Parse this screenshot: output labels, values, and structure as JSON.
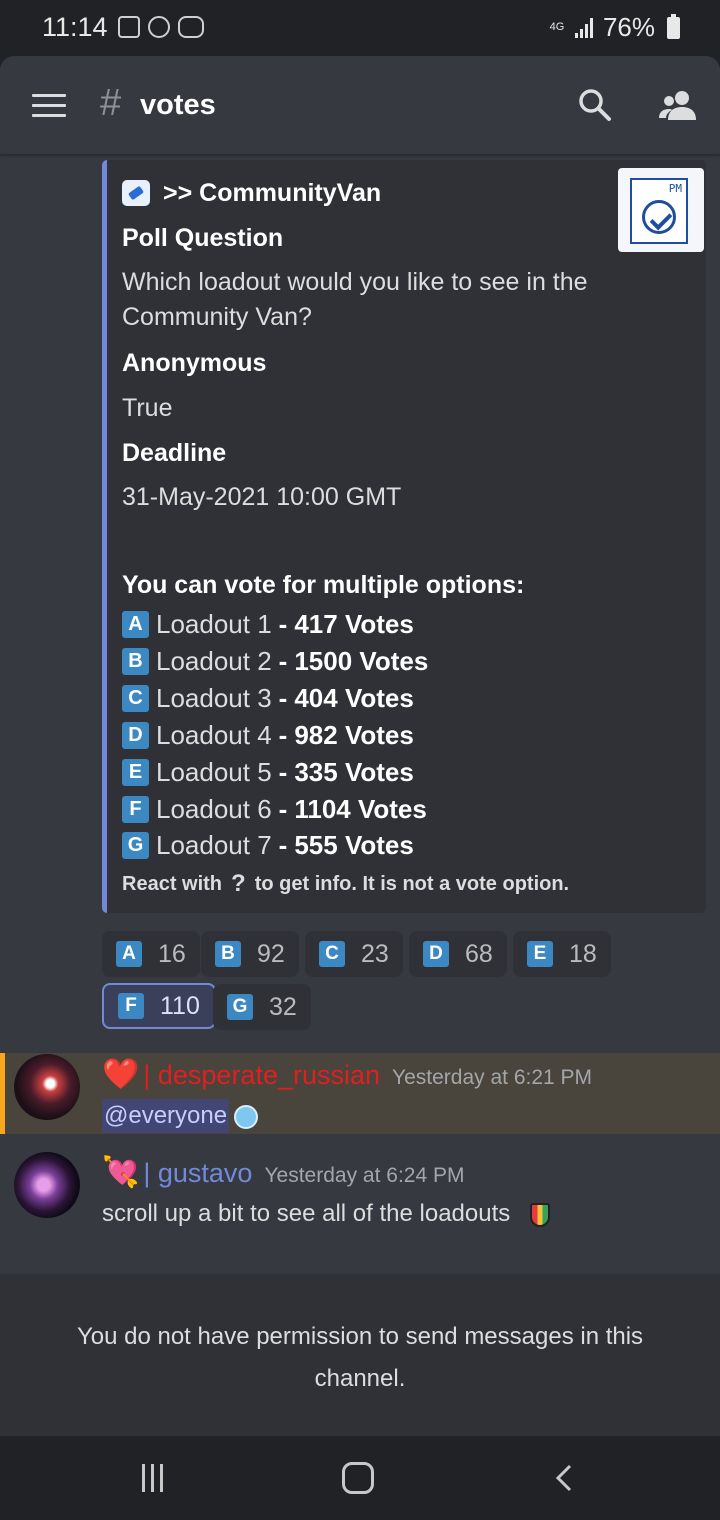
{
  "status_bar": {
    "time": "11:14",
    "network": "4G",
    "battery": "76%"
  },
  "header": {
    "hash": "#",
    "channel": "votes"
  },
  "embed": {
    "author": ">> CommunityVan",
    "fields": [
      {
        "name": "Poll Question",
        "value": "Which loadout would you like to see in the Community Van?"
      },
      {
        "name": "Anonymous",
        "value": "True"
      },
      {
        "name": "Deadline",
        "value": "31-May-2021 10:00 GMT"
      }
    ],
    "thumbnail_text": "PM",
    "options_heading": "You can vote for multiple options:",
    "options": [
      {
        "letter": "A",
        "label": "Loadout 1",
        "sep": "-",
        "votes": "417 Votes"
      },
      {
        "letter": "B",
        "label": "Loadout 2",
        "sep": "-",
        "votes": "1500 Votes"
      },
      {
        "letter": "C",
        "label": "Loadout 3",
        "sep": "-",
        "votes": "404 Votes"
      },
      {
        "letter": "D",
        "label": "Loadout 4",
        "sep": "-",
        "votes": "982 Votes"
      },
      {
        "letter": "E",
        "label": "Loadout 5",
        "sep": "-",
        "votes": "335 Votes"
      },
      {
        "letter": "F",
        "label": "Loadout 6",
        "sep": "-",
        "votes": "1104 Votes"
      },
      {
        "letter": "G",
        "label": "Loadout 7",
        "sep": "-",
        "votes": "555 Votes"
      }
    ],
    "footer_before": "React with",
    "footer_icon": "?",
    "footer_after": "to get info. It is not a vote option."
  },
  "reactions": [
    {
      "letter": "A",
      "count": "16"
    },
    {
      "letter": "B",
      "count": "92"
    },
    {
      "letter": "C",
      "count": "23"
    },
    {
      "letter": "D",
      "count": "68"
    },
    {
      "letter": "E",
      "count": "18"
    },
    {
      "letter": "F",
      "count": "110",
      "active": true
    },
    {
      "letter": "G",
      "count": "32"
    }
  ],
  "messages": [
    {
      "prefix": "❤️",
      "username": "| desperate_russian",
      "timestamp": "Yesterday at 6:21 PM",
      "text": "@everyone",
      "username_color": "#e02020"
    },
    {
      "prefix": "💘",
      "username": "| gustavo",
      "timestamp": "Yesterday at 6:24 PM",
      "text": "scroll up a bit to see all of the loadouts",
      "username_color": "#7289da"
    }
  ],
  "notice": "You do not have permission to send messages in this channel.",
  "colors": {
    "accent": "#7289da",
    "letter_badge": "#3b88c3",
    "mention_highlight": "#faa61a"
  }
}
